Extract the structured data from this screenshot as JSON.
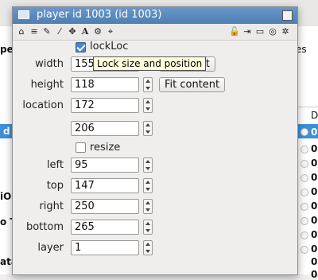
{
  "background": {
    "left_fragments": [
      "pe",
      "d",
      "iO",
      "o T",
      "ata"
    ],
    "right_fragments": [
      "es"
    ],
    "right_column_header": "D",
    "right_column_values": [
      "0",
      "0",
      "0",
      "0",
      "0",
      "0",
      "0",
      "0",
      "0",
      "0",
      "0"
    ]
  },
  "window": {
    "title": "player id 1003 (id 1003)"
  },
  "toolbar": {
    "left_icons": [
      "home-icon",
      "database-icon",
      "pencil-icon",
      "wand-icon",
      "move-icon",
      "text-icon",
      "gears-icon",
      "crosshair-icon"
    ],
    "right_icons": [
      "lock-icon",
      "exit-icon",
      "message-icon",
      "target-icon",
      "settings-icon"
    ],
    "text_icon_glyph": "A"
  },
  "form": {
    "lockloc_label": "lockLoc",
    "lockloc_checked": true,
    "tooltip": "Lock size and position",
    "width_label": "width",
    "width_value": "155",
    "width_button_text": "Content",
    "height_label": "height",
    "height_value": "118",
    "fit_content_label": "Fit content",
    "location_label": "location",
    "location_x": "172",
    "location_y": "206",
    "resize_label": "resize",
    "resize_checked": false,
    "left_label": "left",
    "left_value": "95",
    "top_label": "top",
    "top_value": "147",
    "right_label": "right",
    "right_value": "250",
    "bottom_label": "bottom",
    "bottom_value": "265",
    "layer_label": "layer",
    "layer_value": "1"
  }
}
